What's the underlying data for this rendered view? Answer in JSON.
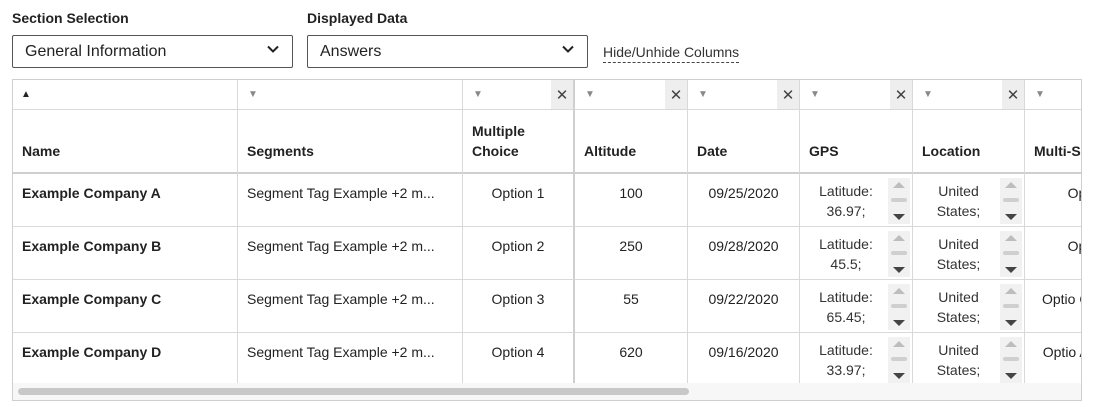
{
  "controls": {
    "section_label": "Section Selection",
    "section_value": "General Information",
    "displayed_label": "Displayed Data",
    "displayed_value": "Answers",
    "hide_link": "Hide/Unhide Columns"
  },
  "columns": [
    {
      "key": "name",
      "label": "Name"
    },
    {
      "key": "segments",
      "label": "Segments"
    },
    {
      "key": "multiple_choice",
      "label": "Multiple Choice"
    },
    {
      "key": "altitude",
      "label": "Altitude"
    },
    {
      "key": "date",
      "label": "Date"
    },
    {
      "key": "gps",
      "label": "GPS"
    },
    {
      "key": "location",
      "label": "Location"
    },
    {
      "key": "multi",
      "label": "Multi-S"
    }
  ],
  "rows": [
    {
      "name": "Example Company A",
      "segments": "Segment Tag Example +2 m...",
      "multiple_choice": "Option 1",
      "altitude": "100",
      "date": "09/25/2020",
      "gps": "Latitude: 36.97;",
      "location": "United States;",
      "multi": "Opti"
    },
    {
      "name": "Example Company B",
      "segments": "Segment Tag Example +2 m...",
      "multiple_choice": "Option 2",
      "altitude": "250",
      "date": "09/28/2020",
      "gps": "Latitude: 45.5;",
      "location": "United States;",
      "multi": "Opti"
    },
    {
      "name": "Example Company C",
      "segments": "Segment Tag Example +2 m...",
      "multiple_choice": "Option 3",
      "altitude": "55",
      "date": "09/22/2020",
      "gps": "Latitude: 65.45;",
      "location": "United States;",
      "multi": "Optio C;Opti"
    },
    {
      "name": "Example Company D",
      "segments": "Segment Tag Example +2 m...",
      "multiple_choice": "Option 4",
      "altitude": "620",
      "date": "09/16/2020",
      "gps": "Latitude: 33.97;",
      "location": "United States;",
      "multi": "Optio A;Opti"
    }
  ],
  "icons": {
    "sort": "sort-ascending-icon",
    "filter": "filter-dropdown-icon",
    "clear": "clear-filter-icon",
    "chevron": "chevron-down-icon"
  }
}
